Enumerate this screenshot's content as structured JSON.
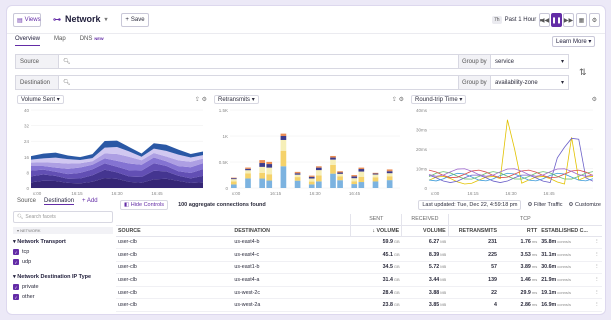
{
  "header": {
    "views_label": "Views",
    "title": "Network",
    "save_label": "Save",
    "timezone": "7h",
    "time_range": "Past 1 Hour"
  },
  "tabs": [
    {
      "label": "Overview"
    },
    {
      "label": "Map"
    },
    {
      "label": "DNS",
      "badge": "NEW"
    }
  ],
  "learn_more": "Learn More",
  "filters": {
    "source_label": "Source",
    "destination_label": "Destination",
    "group_by_label": "Group by",
    "source_group": "service",
    "destination_group": "availability-zone"
  },
  "charts": [
    {
      "title": "Volume Sent"
    },
    {
      "title": "Retransmits"
    },
    {
      "title": "Round-trip Time"
    }
  ],
  "chart_data": [
    {
      "type": "area",
      "title": "Volume Sent",
      "x": [
        "x:00",
        "16:15",
        "16:30",
        "16:45"
      ],
      "yticks": [
        "40",
        "32",
        "24",
        "16",
        "8",
        "0"
      ],
      "ylim": [
        0,
        40
      ],
      "stacked": true,
      "colors": [
        "#2a1a6e",
        "#3a2a8a",
        "#5a46b0",
        "#7d6bd0",
        "#a99ae2",
        "#cfc5f0",
        "#1f4fa0"
      ]
    },
    {
      "type": "bar",
      "title": "Retransmits",
      "x": [
        "x:00",
        "16:15",
        "16:30",
        "16:45"
      ],
      "yticks": [
        "1.5K",
        "1K",
        "0.5K",
        "0"
      ],
      "ylim": [
        0,
        1500
      ],
      "stacked": true,
      "values": [
        180,
        0,
        380,
        0,
        620,
        530,
        0,
        920,
        0,
        330,
        0,
        260,
        400,
        0,
        560,
        330,
        0,
        280,
        390,
        0,
        260,
        0,
        400,
        0
      ],
      "colors": [
        "#7cb3e0",
        "#f5d26a",
        "#f6efb8",
        "#3d3c8c",
        "#e98c54"
      ]
    },
    {
      "type": "line",
      "title": "Round-trip Time",
      "x": [
        "x:00",
        "16:15",
        "16:30",
        "16:45"
      ],
      "yticks": [
        "40ms",
        "30ms",
        "20ms",
        "10ms",
        "0"
      ],
      "ylim": [
        0,
        40
      ],
      "colors": [
        "#e2c200",
        "#6a5fc8",
        "#3b9ad9",
        "#6dc06a",
        "#d94a4a",
        "#9e69cf"
      ]
    }
  ],
  "facets": {
    "tabs": [
      "Source",
      "Destination"
    ],
    "add_label": "Add",
    "search_placeholder": "Search facets",
    "section": "NETWORK",
    "groups": [
      {
        "title": "Network Transport",
        "items": [
          "tcp",
          "udp"
        ]
      },
      {
        "title": "Network Destination IP Type",
        "items": [
          "private",
          "other"
        ]
      }
    ]
  },
  "table_bar": {
    "hide_controls": "Hide Controls",
    "summary": "100 aggregate connections found",
    "last_updated": "Last updated: Tue, Dec 22, 4:59:18 pm",
    "filter_traffic": "Filter Traffic",
    "customize": "Customize"
  },
  "table": {
    "group_headers": {
      "sent": "SENT",
      "received": "RECEIVED",
      "tcp": "TCP"
    },
    "columns": [
      "SOURCE",
      "DESTINATION",
      "VOLUME",
      "VOLUME",
      "RETRANSMITS",
      "RTT",
      "ESTABLISHED C..."
    ],
    "rows": [
      {
        "source": "user-clb",
        "dest": "us-east4-b",
        "sent": "59.9",
        "sent_u": "GB",
        "recv": "6.27",
        "recv_u": "MB",
        "retrans": "231",
        "rtt": "1.76",
        "rtt_u": "ms",
        "est": "35.8m",
        "est_u": "conns/s"
      },
      {
        "source": "user-clb",
        "dest": "us-east4-c",
        "sent": "45.1",
        "sent_u": "GB",
        "recv": "8.39",
        "recv_u": "MB",
        "retrans": "225",
        "rtt": "3.53",
        "rtt_u": "ms",
        "est": "31.1m",
        "est_u": "conns/s"
      },
      {
        "source": "user-clb",
        "dest": "us-east1-b",
        "sent": "34.5",
        "sent_u": "GB",
        "recv": "5.72",
        "recv_u": "MB",
        "retrans": "57",
        "rtt": "3.89",
        "rtt_u": "ms",
        "est": "30.6m",
        "est_u": "conns/s"
      },
      {
        "source": "user-clb",
        "dest": "us-east4-a",
        "sent": "31.4",
        "sent_u": "GB",
        "recv": "3.44",
        "recv_u": "MB",
        "retrans": "139",
        "rtt": "1.46",
        "rtt_u": "ms",
        "est": "21.9m",
        "est_u": "conns/s"
      },
      {
        "source": "user-clb",
        "dest": "us-west-2c",
        "sent": "28.4",
        "sent_u": "GB",
        "recv": "3.88",
        "recv_u": "MB",
        "retrans": "22",
        "rtt": "29.9",
        "rtt_u": "ms",
        "est": "19.1m",
        "est_u": "conns/s"
      },
      {
        "source": "user-clb",
        "dest": "us-west-2a",
        "sent": "23.8",
        "sent_u": "GB",
        "recv": "3.85",
        "recv_u": "MB",
        "retrans": "4",
        "rtt": "2.86",
        "rtt_u": "ms",
        "est": "16.9m",
        "est_u": "conns/s"
      }
    ]
  }
}
